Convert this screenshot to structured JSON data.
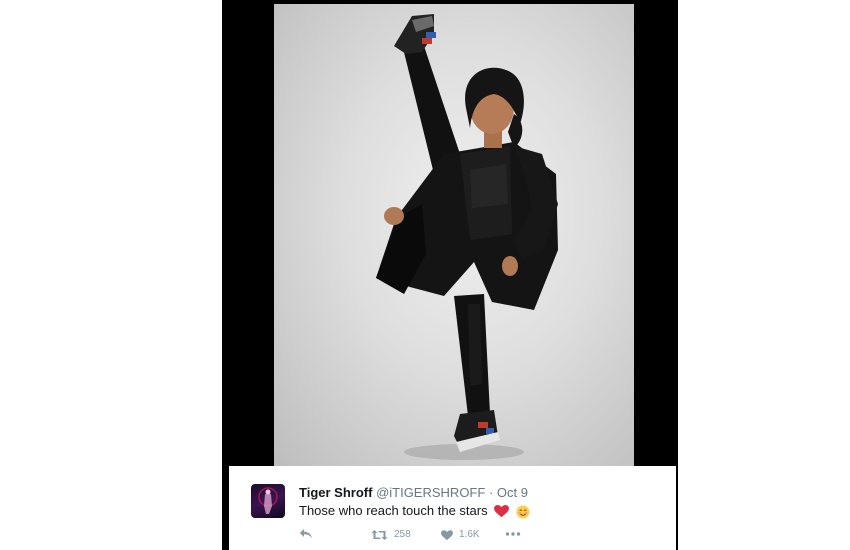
{
  "tweet": {
    "display_name": "Tiger Shroff",
    "handle": "@iTIGERSHROFF",
    "separator": "·",
    "date": "Oct 9",
    "text": "Those who reach touch the stars",
    "emojis": [
      "red-heart-emoji",
      "smiling-face-emoji"
    ],
    "actions": {
      "reply_icon": "reply-icon",
      "retweet_icon": "retweet-icon",
      "retweet_count": "258",
      "like_icon": "heart-icon",
      "like_count": "1.6K",
      "more_icon": "more-icon"
    }
  },
  "colors": {
    "panel_background": "#000000",
    "name": "#14171a",
    "secondary_text": "#657786",
    "action_icons": "#8899a6",
    "heart": "#e0245e"
  }
}
